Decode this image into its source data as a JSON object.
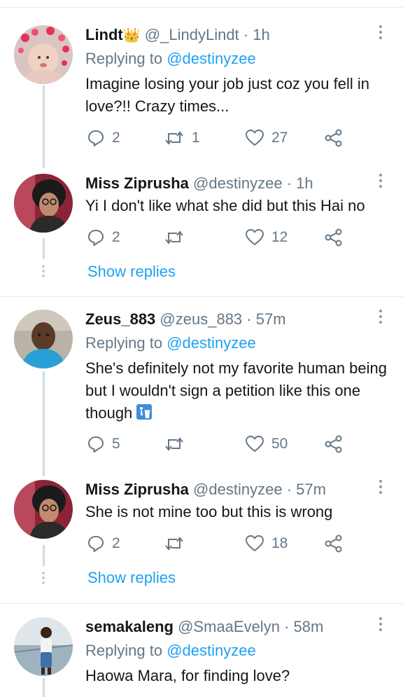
{
  "tweets": [
    {
      "name": "Lindt",
      "badge": "👑",
      "handle": "@_LindyLindt",
      "time": "· 1h",
      "replying_label": "Replying to",
      "replying_to": "@destinyzee",
      "text": "Imagine losing your job just coz you fell in love?!! Crazy times...",
      "replies": "2",
      "retweets": "1",
      "likes": "27"
    },
    {
      "name": "Miss Ziprusha",
      "handle": "@destinyzee",
      "time": "· 1h",
      "text": "Yi I don't like what she did but this Hai no",
      "replies": "2",
      "retweets": "",
      "likes": "12"
    },
    {
      "name": "Zeus_883",
      "handle": "@zeus_883",
      "time": "· 57m",
      "replying_label": "Replying to",
      "replying_to": "@destinyzee",
      "text": "She's definitely not my favorite human being but I wouldn't sign a petition like this one though",
      "emoji": "trash-emoji",
      "replies": "5",
      "retweets": "",
      "likes": "50"
    },
    {
      "name": "Miss Ziprusha",
      "handle": "@destinyzee",
      "time": "· 57m",
      "text": "She is not mine too but this is wrong",
      "replies": "2",
      "retweets": "",
      "likes": "18"
    },
    {
      "name": "semakaleng",
      "handle": "@SmaaEvelyn",
      "time": "· 58m",
      "replying_label": "Replying to",
      "replying_to": "@destinyzee",
      "text": "Haowa Mara, for finding love?"
    }
  ],
  "show_replies_label": "Show replies",
  "colors": {
    "accent": "#1da1f2",
    "muted": "#657786",
    "divider": "#e1e8ed"
  }
}
